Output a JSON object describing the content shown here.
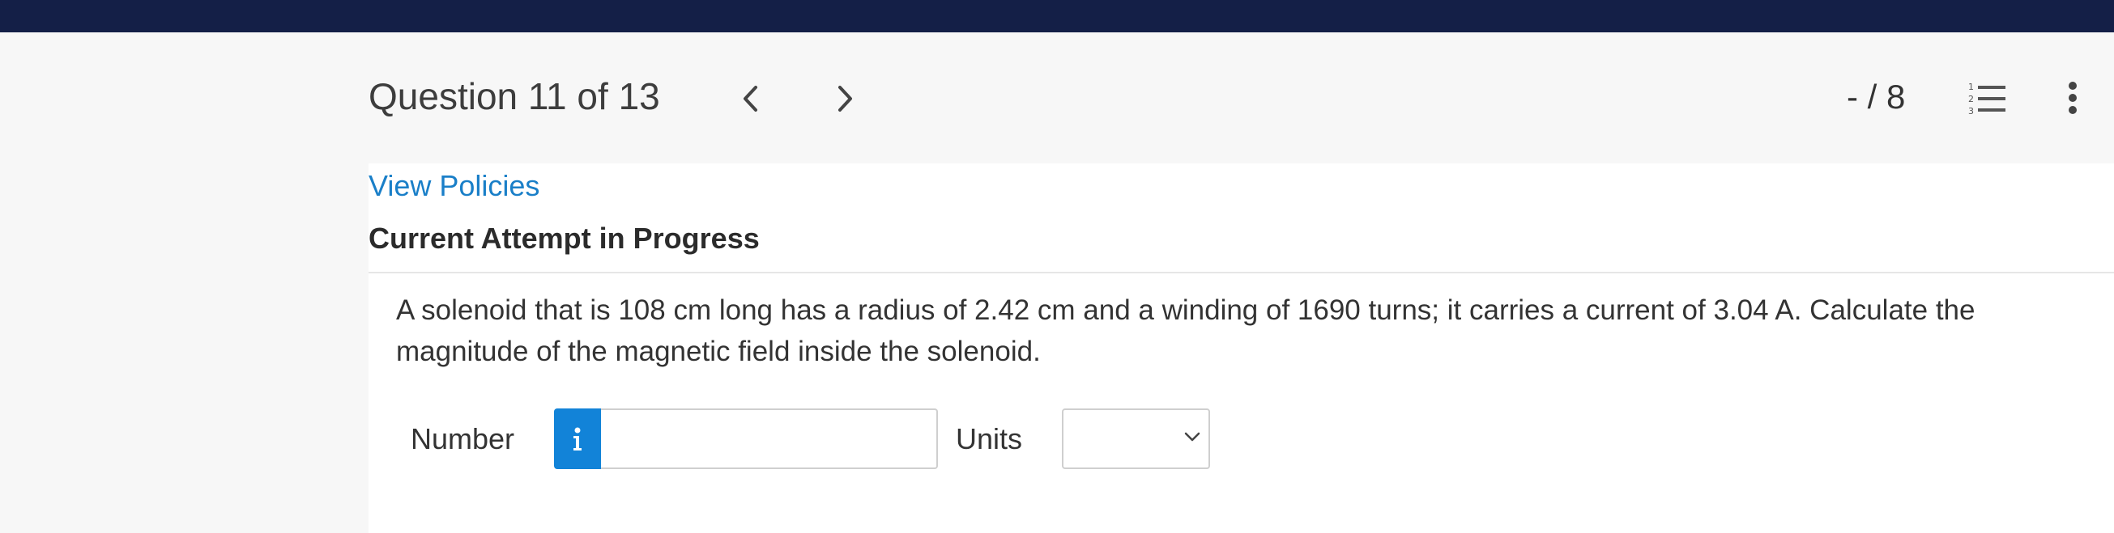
{
  "header": {
    "question_label": "Question 11 of 13",
    "score": "- / 8",
    "prev_icon": "chevron-left-icon",
    "next_icon": "chevron-right-icon",
    "list_icon": "numbered-list-icon",
    "more_icon": "vertical-ellipsis-icon"
  },
  "content": {
    "policies_link": "View Policies",
    "attempt_heading": "Current Attempt in Progress",
    "question_text": "A solenoid that is 108 cm long has a radius of 2.42 cm and a winding of 1690 turns; it carries a current of 3.04 A. Calculate the magnitude of the magnetic field inside the solenoid."
  },
  "answer": {
    "number_label": "Number",
    "number_value": "",
    "info_icon": "info-icon",
    "units_label": "Units",
    "units_selected": "",
    "units_chevron_icon": "chevron-down-icon"
  },
  "colors": {
    "topbar": "#141f47",
    "link": "#1a7fc8",
    "info_button": "#1283d8"
  }
}
